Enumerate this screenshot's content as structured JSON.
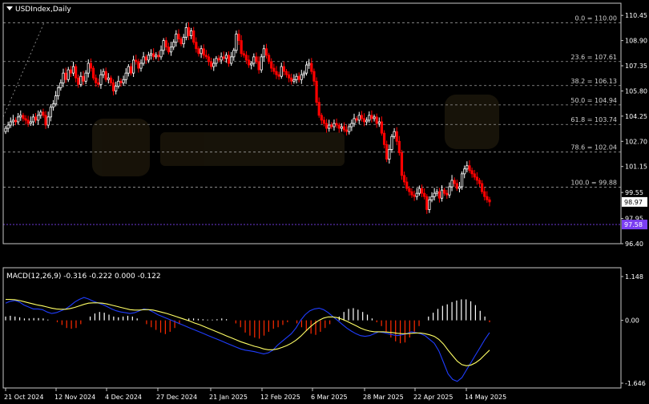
{
  "symbol_label": "USDIndex,Daily",
  "macd_label": "MACD(12,26,9) -0.316 -0.222 0.000 -0.122",
  "colors": {
    "background": "#000000",
    "grid_border": "#c8c8c8",
    "bull_candle": "#ffffff",
    "bear_candle": "#ff0000",
    "fib_line": "#9a9a9a",
    "low_line": "#7b3ff2",
    "current_tag": "#ffffff",
    "low_tag": "#7b3ff2",
    "macd_pos": "#ffffff",
    "macd_neg": "#ff2a00",
    "macd_line": "#1f3dff",
    "signal_line": "#ffff66",
    "watermark": "#2a2210"
  },
  "chart_data": [
    {
      "type": "candlestick",
      "title": "USDIndex,Daily",
      "ylim": [
        96.4,
        111.2
      ],
      "y_ticks": [
        "110.45",
        "108.90",
        "107.35",
        "105.80",
        "104.25",
        "102.70",
        "101.15",
        "99.55",
        "97.95",
        "96.40"
      ],
      "x_ticks": [
        "21 Oct 2024",
        "12 Nov 2024",
        "4 Dec 2024",
        "27 Dec 2024",
        "21 Jan 2025",
        "12 Feb 2025",
        "6 Mar 2025",
        "28 Mar 2025",
        "22 Apr 2025",
        "14 May 2025"
      ],
      "current_price": "98.97",
      "low_price": "97.58",
      "fib_levels": [
        {
          "label": "0.0 = 110.00",
          "value": 110.0
        },
        {
          "label": "23.6 = 107.61",
          "value": 107.61
        },
        {
          "label": "38.2 = 106.13",
          "value": 106.13
        },
        {
          "label": "50.0 = 104.94",
          "value": 104.94
        },
        {
          "label": "61.8 = 103.74",
          "value": 103.74
        },
        {
          "label": "78.6 = 102.04",
          "value": 102.04
        },
        {
          "label": "100.0 = 99.88",
          "value": 99.88
        }
      ],
      "close": [
        103.5,
        103.7,
        103.9,
        104.0,
        103.9,
        104.2,
        104.3,
        104.1,
        104.0,
        103.8,
        103.9,
        104.2,
        104.0,
        104.3,
        104.5,
        104.3,
        103.7,
        104.2,
        104.8,
        105.0,
        105.5,
        106.0,
        106.3,
        106.9,
        106.5,
        107.1,
        106.9,
        107.3,
        106.6,
        106.2,
        106.7,
        106.4,
        106.9,
        107.5,
        107.2,
        106.6,
        106.3,
        106.2,
        106.8,
        107.0,
        106.5,
        106.6,
        106.3,
        105.8,
        106.1,
        106.4,
        106.3,
        106.5,
        106.9,
        107.3,
        106.9,
        107.7,
        107.6,
        107.2,
        107.5,
        107.9,
        107.7,
        108.0,
        108.1,
        107.9,
        108.0,
        107.9,
        108.3,
        108.9,
        108.5,
        108.2,
        108.5,
        108.8,
        109.3,
        109.0,
        108.7,
        109.1,
        109.7,
        109.2,
        109.5,
        108.8,
        108.4,
        108.1,
        108.4,
        108.0,
        107.9,
        107.6,
        107.3,
        107.5,
        107.8,
        107.7,
        107.9,
        107.8,
        108.0,
        107.5,
        107.9,
        108.3,
        109.3,
        108.9,
        108.1,
        108.0,
        107.7,
        107.4,
        107.5,
        107.9,
        107.6,
        107.1,
        107.9,
        108.4,
        108.0,
        107.6,
        107.2,
        107.0,
        106.8,
        106.7,
        107.3,
        107.0,
        106.8,
        106.6,
        106.4,
        106.5,
        106.7,
        106.5,
        106.8,
        106.9,
        107.4,
        107.5,
        107.0,
        106.4,
        105.1,
        104.3,
        104.0,
        103.8,
        103.5,
        103.7,
        103.6,
        103.8,
        103.7,
        103.5,
        103.6,
        103.4,
        103.3,
        103.6,
        103.8,
        104.1,
        104.0,
        104.3,
        104.1,
        103.9,
        104.0,
        104.3,
        104.1,
        104.2,
        103.8,
        103.9,
        103.2,
        102.5,
        101.6,
        102.2,
        103.0,
        103.3,
        102.7,
        102.0,
        100.6,
        100.2,
        99.8,
        99.6,
        99.4,
        99.3,
        99.5,
        99.8,
        99.5,
        99.3,
        98.5,
        99.1,
        99.3,
        99.5,
        99.6,
        99.2,
        99.7,
        99.5,
        99.4,
        99.9,
        100.3,
        100.1,
        99.8,
        99.9,
        100.7,
        101.0,
        101.2,
        100.9,
        100.7,
        100.5,
        100.3,
        100.1,
        99.6,
        99.3,
        99.1,
        98.97
      ],
      "macd_ylim": [
        -1.646,
        1.148
      ],
      "macd_ticks": [
        "1.148",
        "0.00",
        "-1.646"
      ],
      "macd_values": [
        0.45,
        0.5,
        0.52,
        0.48,
        0.4,
        0.35,
        0.3,
        0.3,
        0.28,
        0.22,
        0.18,
        0.2,
        0.25,
        0.3,
        0.38,
        0.48,
        0.55,
        0.6,
        0.56,
        0.5,
        0.46,
        0.42,
        0.36,
        0.3,
        0.25,
        0.22,
        0.2,
        0.18,
        0.2,
        0.25,
        0.3,
        0.28,
        0.22,
        0.15,
        0.1,
        0.05,
        0.0,
        -0.05,
        -0.1,
        -0.15,
        -0.2,
        -0.25,
        -0.3,
        -0.35,
        -0.4,
        -0.45,
        -0.5,
        -0.55,
        -0.6,
        -0.65,
        -0.7,
        -0.75,
        -0.78,
        -0.8,
        -0.82,
        -0.85,
        -0.88,
        -0.85,
        -0.78,
        -0.65,
        -0.55,
        -0.45,
        -0.35,
        -0.2,
        0.0,
        0.15,
        0.25,
        0.3,
        0.32,
        0.28,
        0.2,
        0.1,
        0.0,
        -0.1,
        -0.2,
        -0.28,
        -0.35,
        -0.4,
        -0.42,
        -0.4,
        -0.35,
        -0.3,
        -0.32,
        -0.35,
        -0.38,
        -0.4,
        -0.38,
        -0.35,
        -0.3,
        -0.32,
        -0.35,
        -0.4,
        -0.5,
        -0.6,
        -0.8,
        -1.1,
        -1.4,
        -1.55,
        -1.6,
        -1.5,
        -1.3,
        -1.1,
        -0.9,
        -0.7,
        -0.5,
        -0.32
      ],
      "signal_values": [
        0.55,
        0.55,
        0.54,
        0.52,
        0.49,
        0.46,
        0.43,
        0.4,
        0.38,
        0.35,
        0.32,
        0.3,
        0.29,
        0.29,
        0.31,
        0.34,
        0.38,
        0.42,
        0.45,
        0.46,
        0.46,
        0.45,
        0.43,
        0.4,
        0.37,
        0.34,
        0.31,
        0.28,
        0.27,
        0.27,
        0.28,
        0.28,
        0.27,
        0.24,
        0.21,
        0.18,
        0.14,
        0.1,
        0.06,
        0.02,
        -0.02,
        -0.07,
        -0.11,
        -0.16,
        -0.21,
        -0.26,
        -0.31,
        -0.36,
        -0.41,
        -0.46,
        -0.51,
        -0.56,
        -0.6,
        -0.64,
        -0.68,
        -0.71,
        -0.75,
        -0.77,
        -0.77,
        -0.75,
        -0.71,
        -0.66,
        -0.6,
        -0.52,
        -0.42,
        -0.3,
        -0.18,
        -0.08,
        0.0,
        0.06,
        0.09,
        0.09,
        0.07,
        0.03,
        -0.02,
        -0.08,
        -0.14,
        -0.2,
        -0.25,
        -0.28,
        -0.3,
        -0.3,
        -0.3,
        -0.31,
        -0.32,
        -0.34,
        -0.35,
        -0.35,
        -0.34,
        -0.33,
        -0.33,
        -0.35,
        -0.38,
        -0.42,
        -0.5,
        -0.62,
        -0.78,
        -0.93,
        -1.07,
        -1.16,
        -1.19,
        -1.17,
        -1.11,
        -1.02,
        -0.9,
        -0.78
      ],
      "histogram_values": [
        0.1,
        0.12,
        0.1,
        0.08,
        0.05,
        0.05,
        0.06,
        0.06,
        0.05,
        0.02,
        0.0,
        -0.05,
        -0.12,
        -0.2,
        -0.22,
        -0.2,
        -0.1,
        0.0,
        0.1,
        0.18,
        0.22,
        0.2,
        0.15,
        0.1,
        0.08,
        0.1,
        0.12,
        0.1,
        0.05,
        0.0,
        -0.1,
        -0.18,
        -0.25,
        -0.32,
        -0.36,
        -0.3,
        -0.2,
        -0.1,
        0.0,
        0.05,
        0.05,
        0.04,
        0.03,
        0.02,
        0.02,
        0.03,
        0.05,
        0.03,
        0.0,
        -0.08,
        -0.18,
        -0.32,
        -0.4,
        -0.45,
        -0.48,
        -0.4,
        -0.3,
        -0.22,
        -0.18,
        -0.12,
        -0.05,
        0.0,
        -0.08,
        -0.18,
        -0.28,
        -0.35,
        -0.38,
        -0.3,
        -0.2,
        -0.1,
        0.0,
        0.1,
        0.22,
        0.3,
        0.32,
        0.28,
        0.22,
        0.15,
        0.05,
        -0.05,
        -0.15,
        -0.3,
        -0.45,
        -0.55,
        -0.6,
        -0.58,
        -0.45,
        -0.3,
        -0.15,
        0.0,
        0.1,
        0.2,
        0.3,
        0.38,
        0.42,
        0.48,
        0.52,
        0.55,
        0.55,
        0.5,
        0.4,
        0.25,
        0.1,
        -0.05
      ]
    }
  ]
}
